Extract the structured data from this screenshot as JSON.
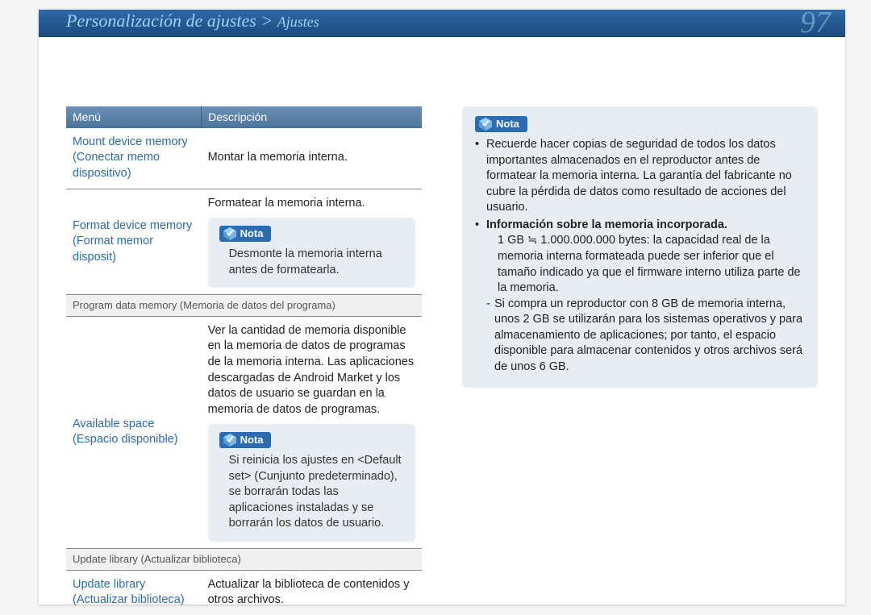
{
  "header": {
    "breadcrumb_main": "Personalización de ajustes",
    "breadcrumb_sep": " > ",
    "breadcrumb_sub": "Ajustes",
    "page_number": "97"
  },
  "table": {
    "headers": {
      "menu": "Menú",
      "desc": "Descripción"
    },
    "rows": {
      "mount": {
        "menu": "Mount device memory (Conectar memo dispositivo)",
        "desc": "Montar la memoria interna."
      },
      "format": {
        "menu": "Format device memory (Format memor disposit)",
        "desc_pre": "Formatear la memoria interna.",
        "note_label": "Nota",
        "note_text": "Desmonte la memoria interna antes de formatearla."
      },
      "section_program": "Program data memory (Memoria de datos del programa)",
      "available": {
        "menu": "Available space (Espacio disponible)",
        "desc_pre": "Ver la cantidad de memoria disponible en la memoria de datos de programas de la memoria interna. Las aplicaciones descargadas de Android Market y los datos de usuario se guardan en la memoria de datos de programas.",
        "note_label": "Nota",
        "note_text": "Si reinicia los ajustes en <Default set> (Cunjunto predeterminado), se borrarán todas las aplicaciones instaladas y se borrarán los datos de usuario."
      },
      "section_update": "Update library (Actualizar biblioteca)",
      "update": {
        "menu": "Update library (Actualizar biblioteca)",
        "desc": "Actualizar la biblioteca de contenidos y otros archivos."
      }
    }
  },
  "right_note": {
    "label": "Nota",
    "bullet1": "Recuerde hacer copias de seguridad de todos los datos importantes almacenados en el reproductor antes de formatear la memoria interna. La garantía del fabricante no cubre la pérdida de datos como resultado de acciones del usuario.",
    "bullet2_title": "Información sobre la memoria incorporada.",
    "bullet2_line1": "1 GB ≒ 1.000.000.000 bytes: la capacidad real de la memoria interna formateada puede ser inferior que el tamaño indicado ya que el firmware interno utiliza parte de la memoria.",
    "bullet2_dash": "Si compra un reproductor con 8 GB de memoria interna, unos 2 GB se utilizarán para los sistemas operativos y para almacenamiento de aplicaciones; por tanto, el espacio disponible para almacenar contenidos y otros archivos será de unos 6 GB."
  }
}
